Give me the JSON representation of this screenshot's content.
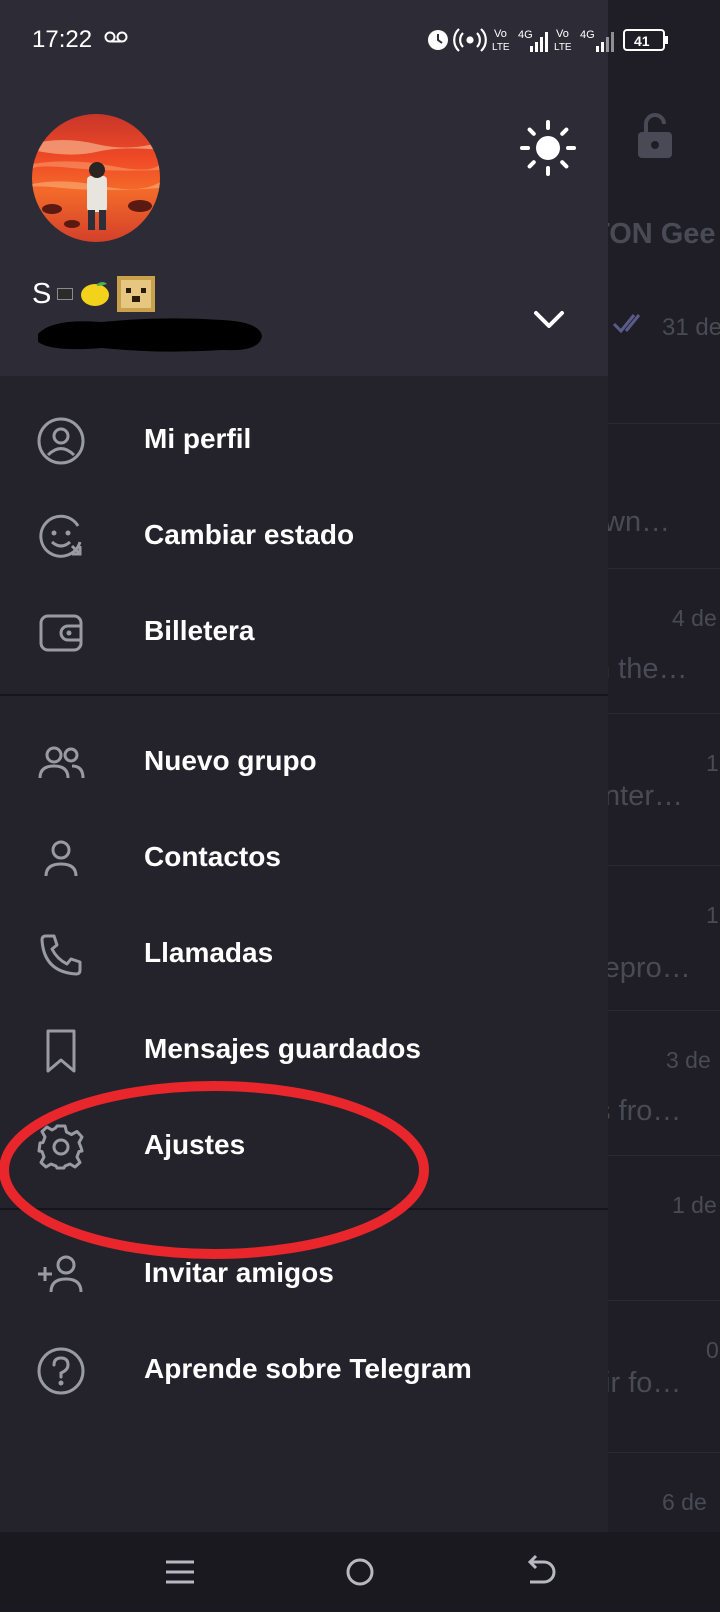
{
  "status_bar": {
    "time": "17:22",
    "network_1": "Vo LTE",
    "network_1_gen": "4G",
    "network_2": "Vo LTE",
    "network_2_gen": "4G",
    "battery": "41"
  },
  "drawer": {
    "profile": {
      "name": "S"
    },
    "menu": {
      "my_profile": "Mi perfil",
      "change_status": "Cambiar estado",
      "wallet": "Billetera",
      "new_group": "Nuevo grupo",
      "contacts": "Contactos",
      "calls": "Llamadas",
      "saved_messages": "Mensajes guardados",
      "settings": "Ajustes",
      "invite_friends": "Invitar amigos",
      "learn_telegram": "Aprende sobre Telegram"
    }
  },
  "background_chats": {
    "header_title": "TON Gee",
    "rows": [
      {
        "time": "31 de",
        "preview": ""
      },
      {
        "time": "",
        "preview": "wn…"
      },
      {
        "time": "4 de",
        "preview": "n the…"
      },
      {
        "time": "1",
        "preview": "nter…"
      },
      {
        "time": "1",
        "preview": "repro…"
      },
      {
        "time": "3 de",
        "preview": "s fro…"
      },
      {
        "time": "1 de",
        "preview": ""
      },
      {
        "time": "0",
        "preview": "tir fo…"
      },
      {
        "time": "6 de",
        "preview": ""
      }
    ]
  },
  "colors": {
    "drawer_bg": "#24232b",
    "header_bg": "#2d2c36",
    "highlight": "#e8262c",
    "icon_gray": "#9a9aa4"
  },
  "icons": {
    "theme": "sun-icon",
    "expand": "chevron-down-icon",
    "my_profile": "user-circle-icon",
    "change_status": "smiley-refresh-icon",
    "wallet": "wallet-icon",
    "new_group": "users-icon",
    "contacts": "user-icon",
    "calls": "phone-icon",
    "saved_messages": "bookmark-icon",
    "settings": "gear-icon",
    "invite_friends": "user-plus-icon",
    "learn_telegram": "question-circle-icon"
  }
}
